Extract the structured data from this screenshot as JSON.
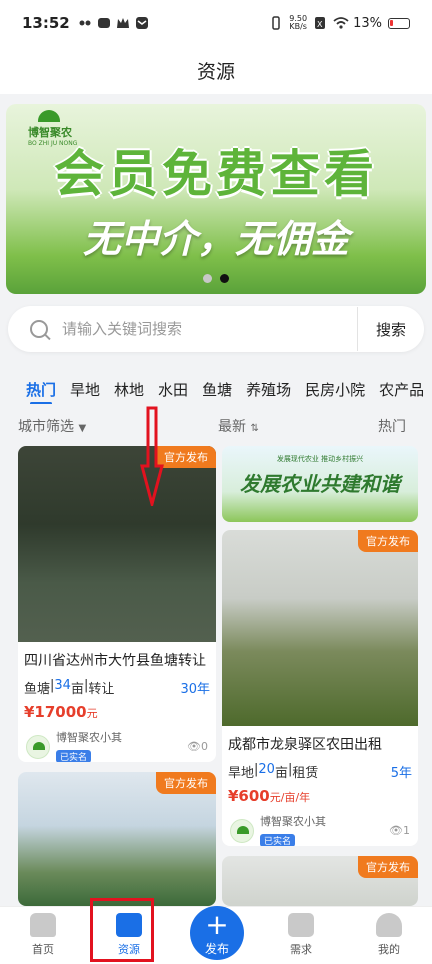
{
  "status": {
    "time": "13:52",
    "speed_top": "9.50",
    "speed_bottom": "KB/s",
    "battery": "13%"
  },
  "navbar": {
    "title": "资源"
  },
  "banner": {
    "logo": "博智聚农",
    "logo_sub": "BO ZHI JU NONG",
    "title": "会员免费查看",
    "subtitle": "无中介，无佣金"
  },
  "search": {
    "placeholder": "请输入关键词搜索",
    "button": "搜索"
  },
  "tabs": [
    "热门",
    "旱地",
    "林地",
    "水田",
    "鱼塘",
    "养殖场",
    "民房小院",
    "农产品"
  ],
  "filters": {
    "city": "城市筛选",
    "latest": "最新",
    "hot": "热门"
  },
  "cards": {
    "badge": "官方发布",
    "c1": {
      "title": "四川省达州市大竹县鱼塘转让",
      "type": "鱼塘",
      "area": "34",
      "unit": "亩",
      "mode": "转让",
      "years": "30年",
      "price": "¥17000",
      "price_unit": "元",
      "publisher": "博智聚农小其",
      "verified": "已实名",
      "views": "0"
    },
    "ad": {
      "text": "发展农业共建和谐",
      "small": "发展现代农业 推动乡村振兴"
    },
    "c2": {
      "title": "成都市龙泉驿区农田出租",
      "type": "旱地",
      "area": "20",
      "unit": "亩",
      "mode": "租赁",
      "years": "5年",
      "price": "¥600",
      "price_unit": "元/亩/年",
      "publisher": "博智聚农小其",
      "verified": "已实名",
      "views": "1"
    }
  },
  "bottom_nav": {
    "home": "首页",
    "resource": "资源",
    "publish": "发布",
    "demand": "需求",
    "mine": "我的"
  },
  "colors": {
    "accent": "#1a6fe6",
    "badge": "#f07a1e",
    "price": "#e63e2b",
    "annotation": "#e2121f"
  }
}
